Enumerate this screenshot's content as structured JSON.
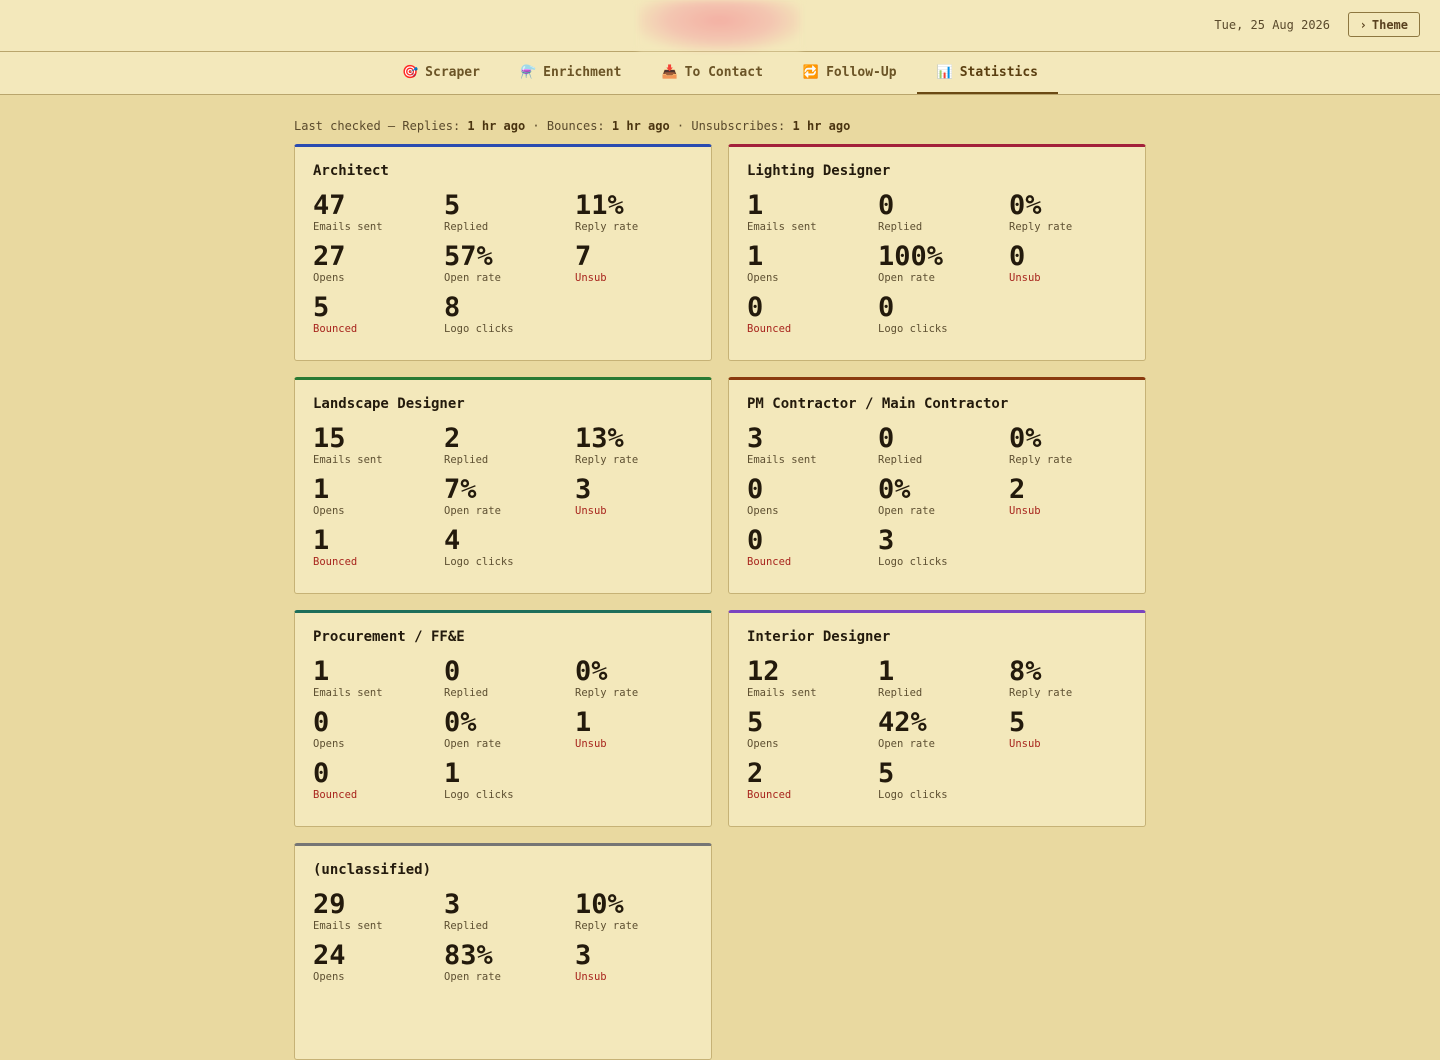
{
  "header": {
    "date": "Tue, 25 Aug 2026",
    "theme_label": "Theme",
    "theme_icon": "›"
  },
  "tabs": [
    {
      "label": "Scraper",
      "icon": "🎯"
    },
    {
      "label": "Enrichment",
      "icon": "⚗️"
    },
    {
      "label": "To Contact",
      "icon": "📥"
    },
    {
      "label": "Follow-Up",
      "icon": "🔁"
    },
    {
      "label": "Statistics",
      "icon": "📊"
    }
  ],
  "last_checked": {
    "prefix": "Last checked — Replies: ",
    "replies": "1 hr ago",
    "sep1": " · Bounces: ",
    "bounces": "1 hr ago",
    "sep2": " · Unsubscribes: ",
    "unsubscribes": "1 hr ago"
  },
  "labels": {
    "sent": "Emails sent",
    "replied": "Replied",
    "reply_rate": "Reply rate",
    "opens": "Opens",
    "open_rate": "Open rate",
    "unsub": "Unsub",
    "bounced": "Bounced",
    "logo_clicks": "Logo clicks"
  },
  "colors": {
    "architect": "#2a4bb0",
    "lighting": "#a3203a",
    "landscape": "#2a7a34",
    "pm": "#8a3a0e",
    "procurement": "#1e6e5a",
    "interior": "#7a44c0",
    "unclassified": "#757575"
  },
  "cards": [
    {
      "title": "Architect",
      "sent": "47",
      "replied": "5",
      "reply_rate": "11%",
      "opens": "27",
      "open_rate": "57%",
      "unsub": "7",
      "bounced": "5",
      "logo_clicks": "8"
    },
    {
      "title": "Lighting Designer",
      "sent": "1",
      "replied": "0",
      "reply_rate": "0%",
      "opens": "1",
      "open_rate": "100%",
      "unsub": "0",
      "bounced": "0",
      "logo_clicks": "0"
    },
    {
      "title": "Landscape Designer",
      "sent": "15",
      "replied": "2",
      "reply_rate": "13%",
      "opens": "1",
      "open_rate": "7%",
      "unsub": "3",
      "bounced": "1",
      "logo_clicks": "4"
    },
    {
      "title": "PM Contractor / Main Contractor",
      "sent": "3",
      "replied": "0",
      "reply_rate": "0%",
      "opens": "0",
      "open_rate": "0%",
      "unsub": "2",
      "bounced": "0",
      "logo_clicks": "3"
    },
    {
      "title": "Procurement / FF&E",
      "sent": "1",
      "replied": "0",
      "reply_rate": "0%",
      "opens": "0",
      "open_rate": "0%",
      "unsub": "1",
      "bounced": "0",
      "logo_clicks": "1"
    },
    {
      "title": "Interior Designer",
      "sent": "12",
      "replied": "1",
      "reply_rate": "8%",
      "opens": "5",
      "open_rate": "42%",
      "unsub": "5",
      "bounced": "2",
      "logo_clicks": "5"
    },
    {
      "title": "(unclassified)",
      "sent": "29",
      "replied": "3",
      "reply_rate": "10%",
      "opens": "24",
      "open_rate": "83%",
      "unsub": "3"
    }
  ]
}
